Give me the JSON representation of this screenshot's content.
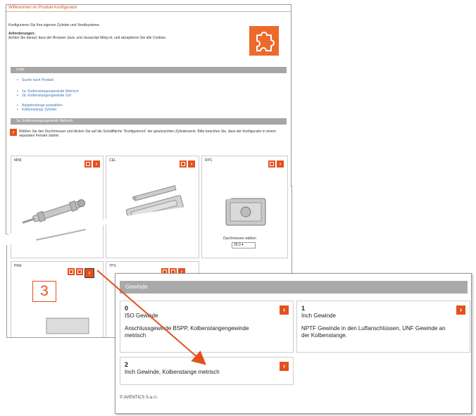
{
  "panel_top": {
    "header_title": "Willkommen im Produkt-Konfigurator",
    "intro": "Konfigurieren Sie Ihre eigenen Zylinder und Ventilsysteme.",
    "req_title": "Anforderungen:",
    "req_text": "Achten Sie darauf, dass der Browser Java- und Javascript fähig ist, und akzeptieren Sie alle Cookies.",
    "section_bar": "Links",
    "links": [
      "Suche nach Produkt",
      "1a. Kolbenstangengewinde Metrisch",
      "1b. Kolbenstangengewinde Zoll",
      "Adapterstange auswählen",
      "Kolbenstange Zylinder"
    ],
    "section_bar2": "1a. Kolbenstangengewinde Metrisch",
    "instruction": "Wählen Sie den Durchmesser und klicken Sie auf die Schaltfläche \"Konfigurieren\" der gewünschten Zylinderserie. Bitte beachten Sie, dass der Konfigurator in einem separaten Fenster startet.",
    "cards": [
      {
        "name": "MINI"
      },
      {
        "name": "CEL"
      },
      {
        "name": "RPC"
      }
    ]
  },
  "panel_middle": {
    "diameter_label": "Durchmesser wählen",
    "diameter_value": "25,0",
    "cards": [
      {
        "name": "PRA"
      },
      {
        "name": "TPS"
      }
    ]
  },
  "step_label": "3",
  "panel_bottom": {
    "bar_title": "Gewinde",
    "options": [
      {
        "num": "0",
        "title": "ISO Gewinde",
        "desc": "Anschlussgewinde BSPP, Kolbenstangengewinde metrisch"
      },
      {
        "num": "1",
        "title": "Inch Gewinde",
        "desc": "NPTF Gewinde in den Luftanschlüssen, UNF Gewinde an der Kolbenstange."
      },
      {
        "num": "2",
        "title": "Inch Gewinde, Kolbenstange metrisch",
        "desc": ""
      }
    ],
    "copyright": "© AVENTICS S.a.r.l."
  },
  "colors": {
    "accent": "#e4501e",
    "bar": "#a6a6a6",
    "link": "#3b78b8"
  },
  "icons": {
    "arrow": "chevron-right-icon",
    "puzzle": "puzzle-icon"
  }
}
